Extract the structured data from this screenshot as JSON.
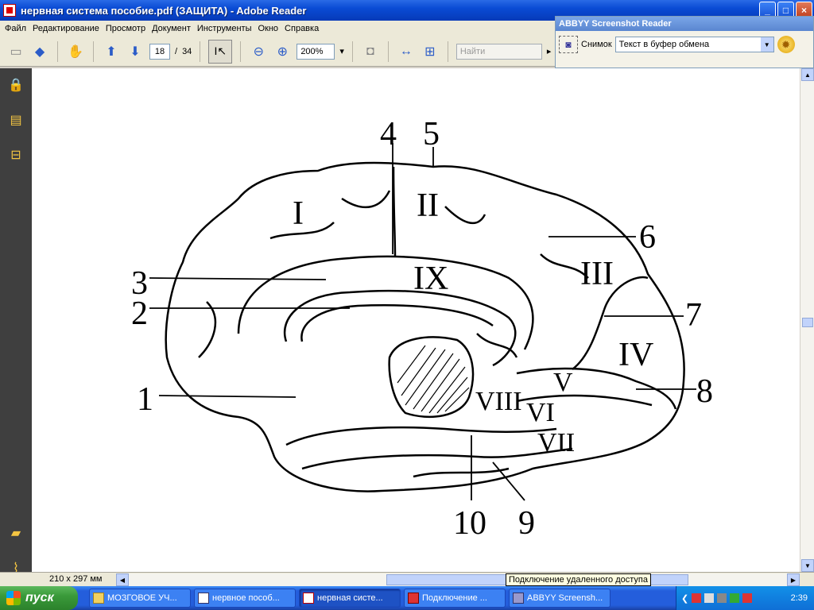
{
  "window": {
    "title": "нервная система  пособие.pdf (ЗАЩИТА) - Adobe Reader",
    "minimize": "_",
    "maximize": "□",
    "close": "×"
  },
  "menu": [
    "Файл",
    "Редактирование",
    "Просмотр",
    "Документ",
    "Инструменты",
    "Окно",
    "Справка"
  ],
  "toolbar": {
    "page_current": "18",
    "page_separator": "/",
    "page_total": "34",
    "zoom": "200%",
    "find_placeholder": "Найти"
  },
  "abbyy": {
    "title": "ABBYY Screenshot Reader",
    "snapshot_label": "Снимок",
    "mode_value": "Текст в буфер обмена"
  },
  "document": {
    "labels": {
      "n1": "1",
      "n2": "2",
      "n3": "3",
      "n4": "4",
      "n5": "5",
      "n6": "6",
      "n7": "7",
      "n8": "8",
      "n9": "9",
      "n10": "10",
      "r1": "I",
      "r2": "II",
      "r3": "III",
      "r4": "IV",
      "r5": "V",
      "r6": "VI",
      "r7": "VII",
      "r8": "VIII",
      "r9": "IX"
    }
  },
  "statusbar": {
    "page_size": "210 x 297 мм",
    "tooltip": "Подключение удаленного доступа"
  },
  "taskbar": {
    "start": "пуск",
    "tasks": [
      "МОЗГОВОЕ УЧ...",
      "нервное пособ...",
      "нервная систе...",
      "Подключение ...",
      "ABBYY Screensh..."
    ],
    "clock": "2:39"
  }
}
